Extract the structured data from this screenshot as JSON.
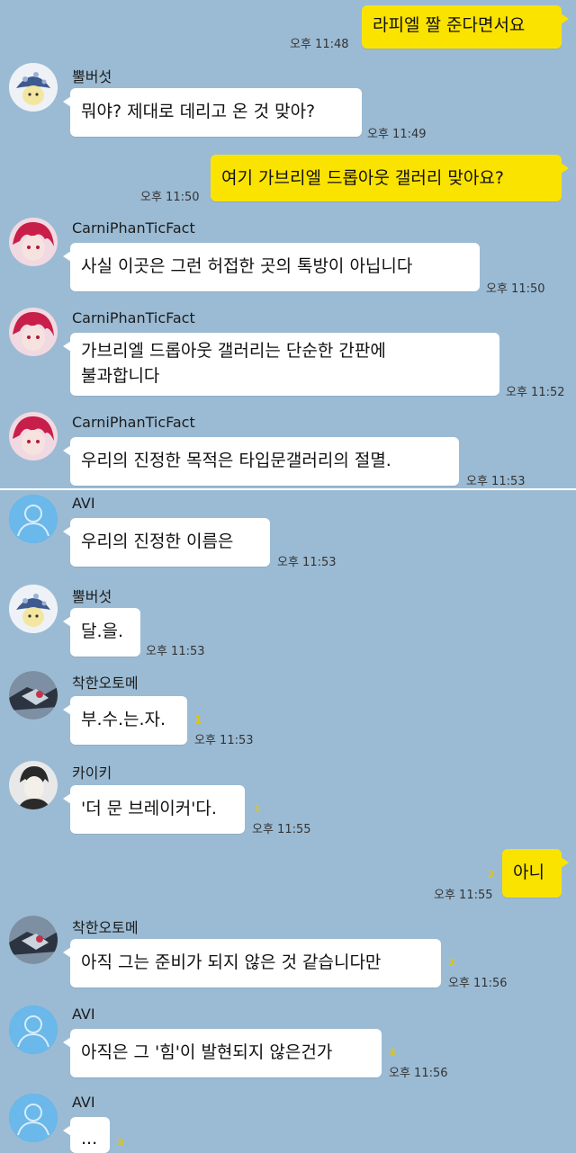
{
  "messages": [
    {
      "id": "m1",
      "side": "right",
      "text": "라피엘 짤 준다면서요",
      "time": "오후 11:48"
    },
    {
      "id": "m2",
      "side": "left",
      "sender": "뿔버섯",
      "text": "뭐야? 제대로 데리고 온 것 맞아?",
      "time": "오후 11:49"
    },
    {
      "id": "m3",
      "side": "right",
      "text": "여기 가브리엘 드롭아웃 갤러리 맞아요?",
      "time": "오후 11:50"
    },
    {
      "id": "m4",
      "side": "left",
      "sender": "CarniPhanTicFact",
      "text": "사실 이곳은 그런 허접한 곳의 톡방이 아닙니다",
      "time": "오후 11:50"
    },
    {
      "id": "m5",
      "side": "left",
      "sender": "CarniPhanTicFact",
      "line1": "가브리엘 드롭아웃 갤러리는 단순한 간판에",
      "line2": "불과합니다",
      "time": "오후 11:52"
    },
    {
      "id": "m6",
      "side": "left",
      "sender": "CarniPhanTicFact",
      "text": "우리의 진정한 목적은 타입문갤러리의 절멸.",
      "time": "오후 11:53"
    },
    {
      "id": "m7",
      "side": "left",
      "sender": "AVI",
      "text": "우리의 진정한 이름은",
      "time": "오후 11:53"
    },
    {
      "id": "m8",
      "side": "left",
      "sender": "뿔버섯",
      "text": "달.을.",
      "time": "오후 11:53"
    },
    {
      "id": "m9",
      "side": "left",
      "sender": "착한오토메",
      "text": "부.수.는.자.",
      "unread": "1",
      "time": "오후 11:53"
    },
    {
      "id": "m10",
      "side": "left",
      "sender": "카이키",
      "text": "'더 문 브레이커'다.",
      "unread": "1",
      "time": "오후 11:55"
    },
    {
      "id": "m11",
      "side": "right",
      "text": "아니",
      "unread": "2",
      "time": "오후 11:55"
    },
    {
      "id": "m12",
      "side": "left",
      "sender": "착한오토메",
      "text": "아직 그는 준비가 되지 않은 것 같습니다만",
      "unread": "2",
      "time": "오후 11:56"
    },
    {
      "id": "m13",
      "side": "left",
      "sender": "AVI",
      "text": "아직은 그 '힘'이 발현되지 않은건가",
      "unread": "3",
      "time": "오후 11:56"
    },
    {
      "id": "m14",
      "side": "left",
      "sender": "AVI",
      "text": "...",
      "unread": "3"
    }
  ],
  "colors": {
    "background": "#9bbbd4",
    "mine": "#fbe300",
    "theirs": "#ffffff"
  }
}
